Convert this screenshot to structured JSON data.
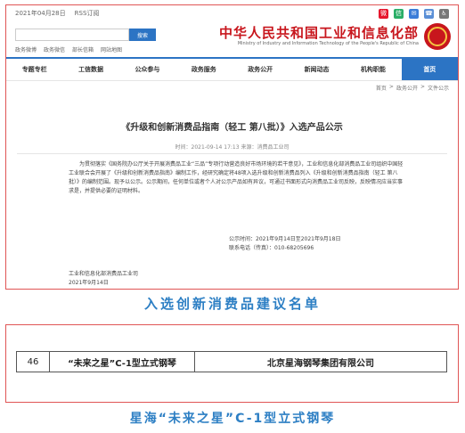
{
  "util": {
    "date": "2021年04月28日",
    "feed": "RSS订阅",
    "icons": [
      "weibo-icon",
      "wechat-icon",
      "mail-icon",
      "phone-icon",
      "accessibility-icon"
    ]
  },
  "header": {
    "title": "中华人民共和国工业和信息化部",
    "subtitle": "Ministry of Industry and Information Technology of the People's Republic of China",
    "search_placeholder": "",
    "search_btn": "搜索",
    "quick_links": [
      "政务微博",
      "政务微信",
      "部长信箱",
      "网站地图"
    ]
  },
  "nav": [
    "首页",
    "机构职能",
    "新闻动态",
    "政务公开",
    "政务服务",
    "公众参与",
    "工信数据",
    "专题专栏"
  ],
  "breadcrumb": [
    "首页",
    "政务公开",
    "文件公示"
  ],
  "article": {
    "title": "《升级和创新消费品指南（轻工 第八批）》入选产品公示",
    "meta": "时间：2021-09-14 17:13  来源：消费品工业司",
    "body": "为贯彻落实《国务院办公厅关于开展消费品工业“三品”专项行动营造良好市场环境的若干意见》，工业和信息化部消费品工业司组织中国轻工业联合会开展了《升级和创新消费品指南》编制工作，经研究确定将48项入选升级和创新消费品列入《升级和创新消费品指南（轻工 第八批）》的编制范围。现予以公示。公示期间，任何单位或者个人对公示产品如有异议，可通过书面形式向消费品工业司反映，反映情况应当实事求是，并提供必要的证明材料。",
    "contact": [
      "公示时间：2021年9月14日至2021年9月18日",
      "联系电话（传真）：010-68205696"
    ],
    "sign": [
      "工业和信息化部消费品工业司",
      "2021年9月14日"
    ]
  },
  "caption_top": "入选创新消费品建议名单",
  "table": {
    "rows": [
      {
        "no": "46",
        "product": "“未来之星”C-1型立式钢琴",
        "company": "北京星海钢琴集团有限公司"
      }
    ]
  },
  "caption_bottom": "星海“未来之星”C-1型立式钢琴"
}
